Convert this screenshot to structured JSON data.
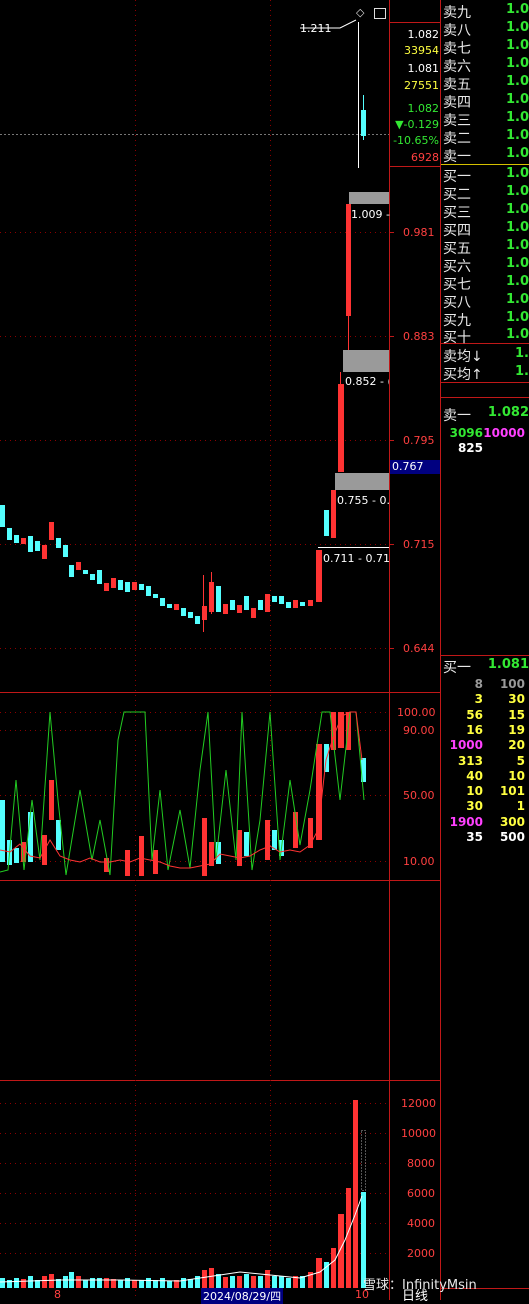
{
  "price_axis": {
    "levels": [
      "0.981",
      "0.883",
      "0.795",
      "0.715",
      "0.644"
    ],
    "current_tag": "0.767"
  },
  "quote": {
    "high_label": "1.211",
    "open": "1.082",
    "volume": "33954",
    "prev_close": "1.081",
    "amount": "27551",
    "last": "1.082",
    "change": "▼-0.129",
    "change_pct": "-10.65%",
    "last_vol": "6928"
  },
  "gap_labels": [
    "1.009 -",
    "0.852 - (",
    "0.755 - 0.",
    "0.711 - 0.71"
  ],
  "indicator_axis": [
    "100.00",
    "90.00",
    "50.00",
    "10.00"
  ],
  "volume_axis": [
    "12000",
    "10000",
    "8000",
    "6000",
    "4000",
    "2000"
  ],
  "x_axis": {
    "left_tick": "8",
    "date": "2024/08/29/四",
    "right_tick": "10",
    "period": "日线"
  },
  "order_book": {
    "asks": [
      {
        "name": "卖九",
        "price": "1.0"
      },
      {
        "name": "卖八",
        "price": "1.0"
      },
      {
        "name": "卖七",
        "price": "1.0"
      },
      {
        "name": "卖六",
        "price": "1.0"
      },
      {
        "name": "卖五",
        "price": "1.0"
      },
      {
        "name": "卖四",
        "price": "1.0"
      },
      {
        "name": "卖三",
        "price": "1.0"
      },
      {
        "name": "卖二",
        "price": "1.0"
      },
      {
        "name": "卖一",
        "price": "1.0"
      }
    ],
    "bids": [
      {
        "name": "买一",
        "price": "1.0"
      },
      {
        "name": "买二",
        "price": "1.0"
      },
      {
        "name": "买三",
        "price": "1.0"
      },
      {
        "name": "买四",
        "price": "1.0"
      },
      {
        "name": "买五",
        "price": "1.0"
      },
      {
        "name": "买六",
        "price": "1.0"
      },
      {
        "name": "买七",
        "price": "1.0"
      },
      {
        "name": "买八",
        "price": "1.0"
      },
      {
        "name": "买九",
        "price": "1.0"
      },
      {
        "name": "买十",
        "price": "1.0"
      }
    ],
    "ask_avg": {
      "name": "卖均↓",
      "price": "1."
    },
    "bid_avg": {
      "name": "买均↑",
      "price": "1."
    }
  },
  "ask_queue": {
    "label": "卖一",
    "price": "1.082",
    "q1": "3096",
    "q2": "10000",
    "q3": "825"
  },
  "bid_queue": {
    "label": "买一",
    "price": "1.081",
    "rows": [
      {
        "a": "8",
        "b": "100",
        "ca": "#9a9a9a",
        "cb": "#9a9a9a"
      },
      {
        "a": "3",
        "b": "30",
        "ca": "#ffff40",
        "cb": "#ffff40"
      },
      {
        "a": "56",
        "b": "15",
        "ca": "#ffff40",
        "cb": "#ffff40"
      },
      {
        "a": "16",
        "b": "19",
        "ca": "#ffff40",
        "cb": "#ffff40"
      },
      {
        "a": "1000",
        "b": "20",
        "ca": "#ff40ff",
        "cb": "#ffff40"
      },
      {
        "a": "313",
        "b": "5",
        "ca": "#ffff40",
        "cb": "#ffff40"
      },
      {
        "a": "40",
        "b": "10",
        "ca": "#ffff40",
        "cb": "#ffff40"
      },
      {
        "a": "10",
        "b": "101",
        "ca": "#ffff40",
        "cb": "#ffff40"
      },
      {
        "a": "30",
        "b": "1",
        "ca": "#ffff40",
        "cb": "#ffff40"
      },
      {
        "a": "1900",
        "b": "300",
        "ca": "#ff40ff",
        "cb": "#ffff40"
      },
      {
        "a": "35",
        "b": "500",
        "ca": "#ffffff",
        "cb": "#ffffff"
      }
    ]
  },
  "watermark": "雪球：InfinityMsin",
  "colors": {
    "up": "#ff3333",
    "down": "#54ffff",
    "grid": "#8b0000",
    "frame": "#c01818",
    "ask_price": "#33e833",
    "tag_bg": "#000080"
  }
}
